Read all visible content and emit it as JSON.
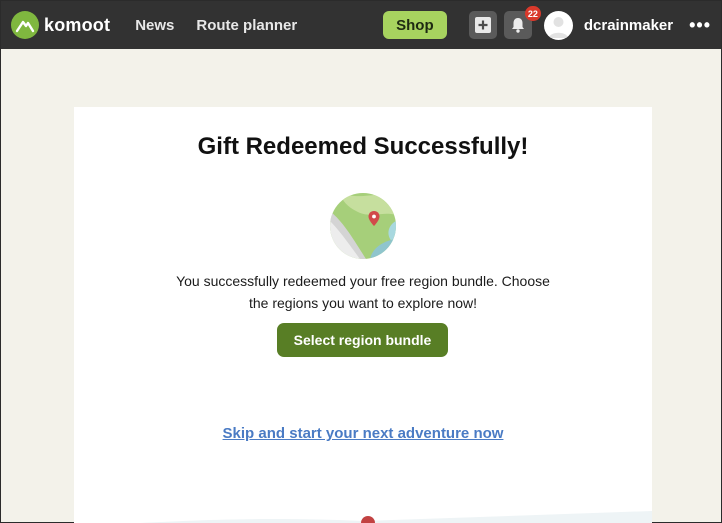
{
  "header": {
    "brand": "komoot",
    "nav": [
      "News",
      "Route planner"
    ],
    "shop_label": "Shop",
    "notification_count": "22",
    "username": "dcrainmaker",
    "icons": {
      "logo": "komoot-logo-icon",
      "add": "plus-square-icon",
      "notifications": "bell-icon",
      "avatar": "user-avatar-icon",
      "more": "more-horizontal-icon"
    }
  },
  "card": {
    "title": "Gift Redeemed Successfully!",
    "illustration": "map-pin-icon",
    "message_line1": "You successfully redeemed your free region bundle. Choose",
    "message_line2": "the regions you want to explore now!",
    "primary_button": "Select region bundle",
    "skip_link": "Skip and start your next adventure now"
  },
  "colors": {
    "topbar": "#323232",
    "shop": "#a7d35f",
    "primary": "#587e25",
    "link": "#4a7bc4",
    "badge": "#d9392b",
    "background": "#f3f2ea"
  }
}
